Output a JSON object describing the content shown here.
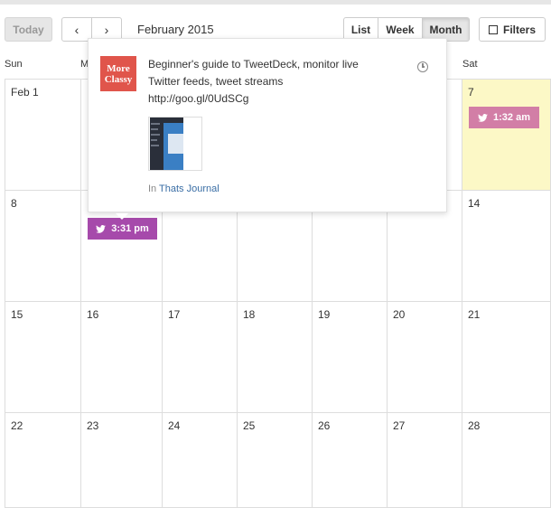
{
  "toolbar": {
    "today_label": "Today",
    "prev_label": "‹",
    "next_label": "›",
    "month_title": "February 2015",
    "view_list": "List",
    "view_week": "Week",
    "view_month": "Month",
    "view_selected": "Month",
    "filters_label": "Filters"
  },
  "day_headers": [
    "Sun",
    "M",
    "Sat"
  ],
  "weeks": [
    [
      "Feb 1",
      "",
      "",
      "",
      "",
      "",
      "7"
    ],
    [
      "8",
      "",
      "",
      "",
      "",
      "",
      "14"
    ],
    [
      "15",
      "16",
      "17",
      "18",
      "19",
      "20",
      "21"
    ],
    [
      "22",
      "23",
      "24",
      "25",
      "26",
      "27",
      "28"
    ]
  ],
  "events": [
    {
      "time": "1:32 am",
      "icon": "twitter-icon",
      "color": "#d27ea6"
    },
    {
      "time": "3:31 pm",
      "icon": "twitter-icon",
      "color": "#a64aab"
    }
  ],
  "popover": {
    "logo_line1": "More",
    "logo_line2": "Classy",
    "text_line1": "Beginner's guide to TweetDeck, monitor live",
    "text_line2": "Twitter feeds, tweet streams",
    "text_line3": "http://goo.gl/0UdSCg",
    "via_prefix": "In",
    "via_link": "Thats Journal",
    "icon": "clock-icon"
  },
  "colors": {
    "today_highlight": "#fcf8c6",
    "logo_bg": "#e0554b",
    "link": "#3a6ea5"
  }
}
